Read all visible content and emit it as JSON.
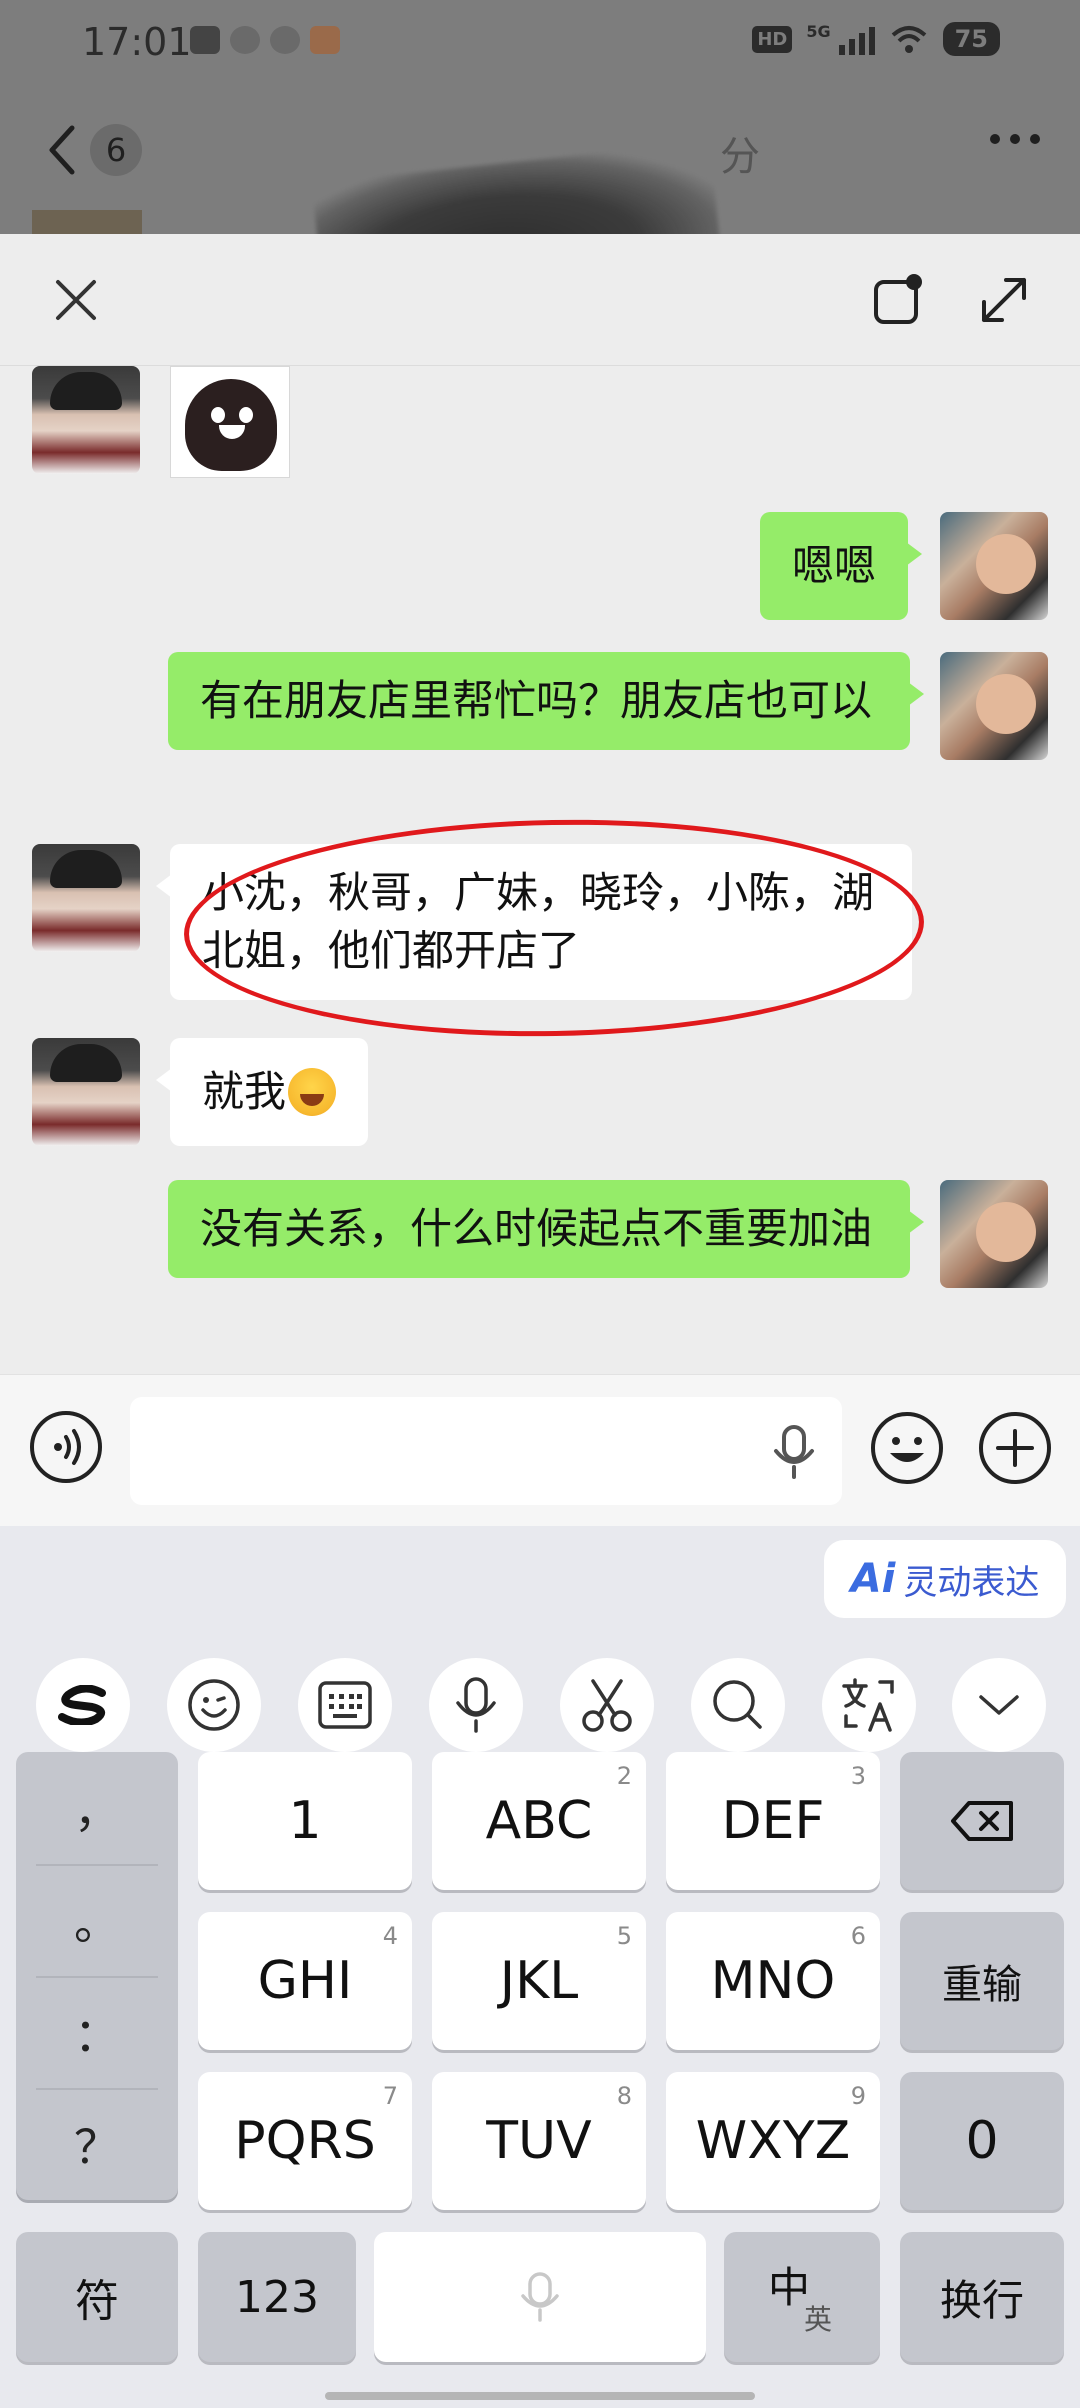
{
  "status_bar": {
    "time": "17:01",
    "hd_label": "HD",
    "network_label": "5G",
    "battery": "75"
  },
  "chat_header": {
    "unread_count": "6",
    "title_fragment": "分"
  },
  "messages": [
    {
      "side": "left",
      "kind": "sticker"
    },
    {
      "side": "right",
      "kind": "text",
      "text": "嗯嗯"
    },
    {
      "side": "right",
      "kind": "text",
      "text": "有在朋友店里帮忙吗？朋友店也可以"
    },
    {
      "side": "left",
      "kind": "text",
      "text": "小沈，秋哥，广妹，晓玲，小陈，湖北姐，他们都开店了"
    },
    {
      "side": "left",
      "kind": "text",
      "text": "就我"
    },
    {
      "side": "right",
      "kind": "text",
      "text": "没有关系，什么时候起点不重要加油"
    }
  ],
  "input": {
    "value": ""
  },
  "keyboard": {
    "ai_chip_glyph": "Ai",
    "ai_chip_label": "灵动表达",
    "toolbar_icons": [
      "swipe-logo-icon",
      "emoji-face-icon",
      "keyboard-icon",
      "mic-icon",
      "scissors-icon",
      "search-icon",
      "translate-icon",
      "chevron-down-icon"
    ],
    "punctuation": [
      "，",
      "。",
      "：",
      "？"
    ],
    "keys": {
      "k1": {
        "label": "1",
        "sup": ""
      },
      "k2": {
        "label": "ABC",
        "sup": "2"
      },
      "k3": {
        "label": "DEF",
        "sup": "3"
      },
      "k4": {
        "label": "GHI",
        "sup": "4"
      },
      "k5": {
        "label": "JKL",
        "sup": "5"
      },
      "k6": {
        "label": "MNO",
        "sup": "6"
      },
      "k7": {
        "label": "PQRS",
        "sup": "7"
      },
      "k8": {
        "label": "TUV",
        "sup": "8"
      },
      "k9": {
        "label": "WXYZ",
        "sup": "9"
      }
    },
    "reinput": "重输",
    "zero": "0",
    "symbol": "符",
    "numeric": "123",
    "lang_main": "中",
    "lang_sub": "英",
    "enter": "换行"
  },
  "colors": {
    "sent_bubble": "#95ec69",
    "received_bubble": "#ffffff",
    "highlight_circle": "#e0191c",
    "ai_accent": "#3b6ce0"
  }
}
